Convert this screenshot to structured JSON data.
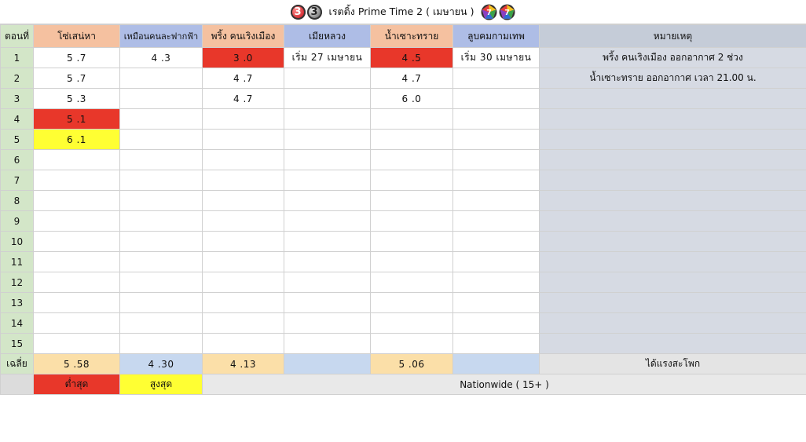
{
  "title": {
    "text": "เรตติ้ง Prime Time 2 ( เมษายน )",
    "logo_left_1": "3",
    "logo_left_2": "3"
  },
  "headers": {
    "episode": "ตอนที่",
    "show1": "โซ่เสน่หา",
    "show2": "เหมือนคนละฟากฟ้า",
    "show3": "พริ้ง คนเริงเมือง",
    "show4": "เมียหลวง",
    "show5": "น้ำเซาะทราย",
    "show6": "ลูบคมกามเทพ",
    "notes": "หมายเหตุ"
  },
  "rows": [
    {
      "ep": "1",
      "s1": "5 .7",
      "s2": "4 .3",
      "s3": "3 .0",
      "s4": "เริ่ม 27 เมษายน",
      "s5": "4 .5",
      "s6": "เริ่ม 30 เมษายน",
      "note": "พริ้ง คนเริงเมือง ออกอากาศ 2 ช่วง"
    },
    {
      "ep": "2",
      "s1": "5 .7",
      "s2": "",
      "s3": "4 .7",
      "s4": "",
      "s5": "4 .7",
      "s6": "",
      "note": "น้ำเซาะทราย ออกอากาศ เวลา 21.00 น."
    },
    {
      "ep": "3",
      "s1": "5 .3",
      "s2": "",
      "s3": "4 .7",
      "s4": "",
      "s5": "6 .0",
      "s6": "",
      "note": ""
    },
    {
      "ep": "4",
      "s1": "5 .1",
      "s2": "",
      "s3": "",
      "s4": "",
      "s5": "",
      "s6": "",
      "note": ""
    },
    {
      "ep": "5",
      "s1": "6 .1",
      "s2": "",
      "s3": "",
      "s4": "",
      "s5": "",
      "s6": "",
      "note": ""
    },
    {
      "ep": "6",
      "s1": "",
      "s2": "",
      "s3": "",
      "s4": "",
      "s5": "",
      "s6": "",
      "note": ""
    },
    {
      "ep": "7",
      "s1": "",
      "s2": "",
      "s3": "",
      "s4": "",
      "s5": "",
      "s6": "",
      "note": ""
    },
    {
      "ep": "8",
      "s1": "",
      "s2": "",
      "s3": "",
      "s4": "",
      "s5": "",
      "s6": "",
      "note": ""
    },
    {
      "ep": "9",
      "s1": "",
      "s2": "",
      "s3": "",
      "s4": "",
      "s5": "",
      "s6": "",
      "note": ""
    },
    {
      "ep": "10",
      "s1": "",
      "s2": "",
      "s3": "",
      "s4": "",
      "s5": "",
      "s6": "",
      "note": ""
    },
    {
      "ep": "11",
      "s1": "",
      "s2": "",
      "s3": "",
      "s4": "",
      "s5": "",
      "s6": "",
      "note": ""
    },
    {
      "ep": "12",
      "s1": "",
      "s2": "",
      "s3": "",
      "s4": "",
      "s5": "",
      "s6": "",
      "note": ""
    },
    {
      "ep": "13",
      "s1": "",
      "s2": "",
      "s3": "",
      "s4": "",
      "s5": "",
      "s6": "",
      "note": ""
    },
    {
      "ep": "14",
      "s1": "",
      "s2": "",
      "s3": "",
      "s4": "",
      "s5": "",
      "s6": "",
      "note": ""
    },
    {
      "ep": "15",
      "s1": "",
      "s2": "",
      "s3": "",
      "s4": "",
      "s5": "",
      "s6": "",
      "note": ""
    }
  ],
  "average": {
    "label": "เฉลี่ย",
    "s1": "5 .58",
    "s2": "4 .30",
    "s3": "4 .13",
    "s4": "",
    "s5": "5 .06",
    "s6": "",
    "note": "ได้แรงสะโพก"
  },
  "legend": {
    "lowest": "ต่ำสุด",
    "highest": "สูงสุด",
    "scope": "Nationwide ( 15+ )"
  },
  "colors": {
    "lowest": "#e8372a",
    "highest": "#ffff33"
  }
}
